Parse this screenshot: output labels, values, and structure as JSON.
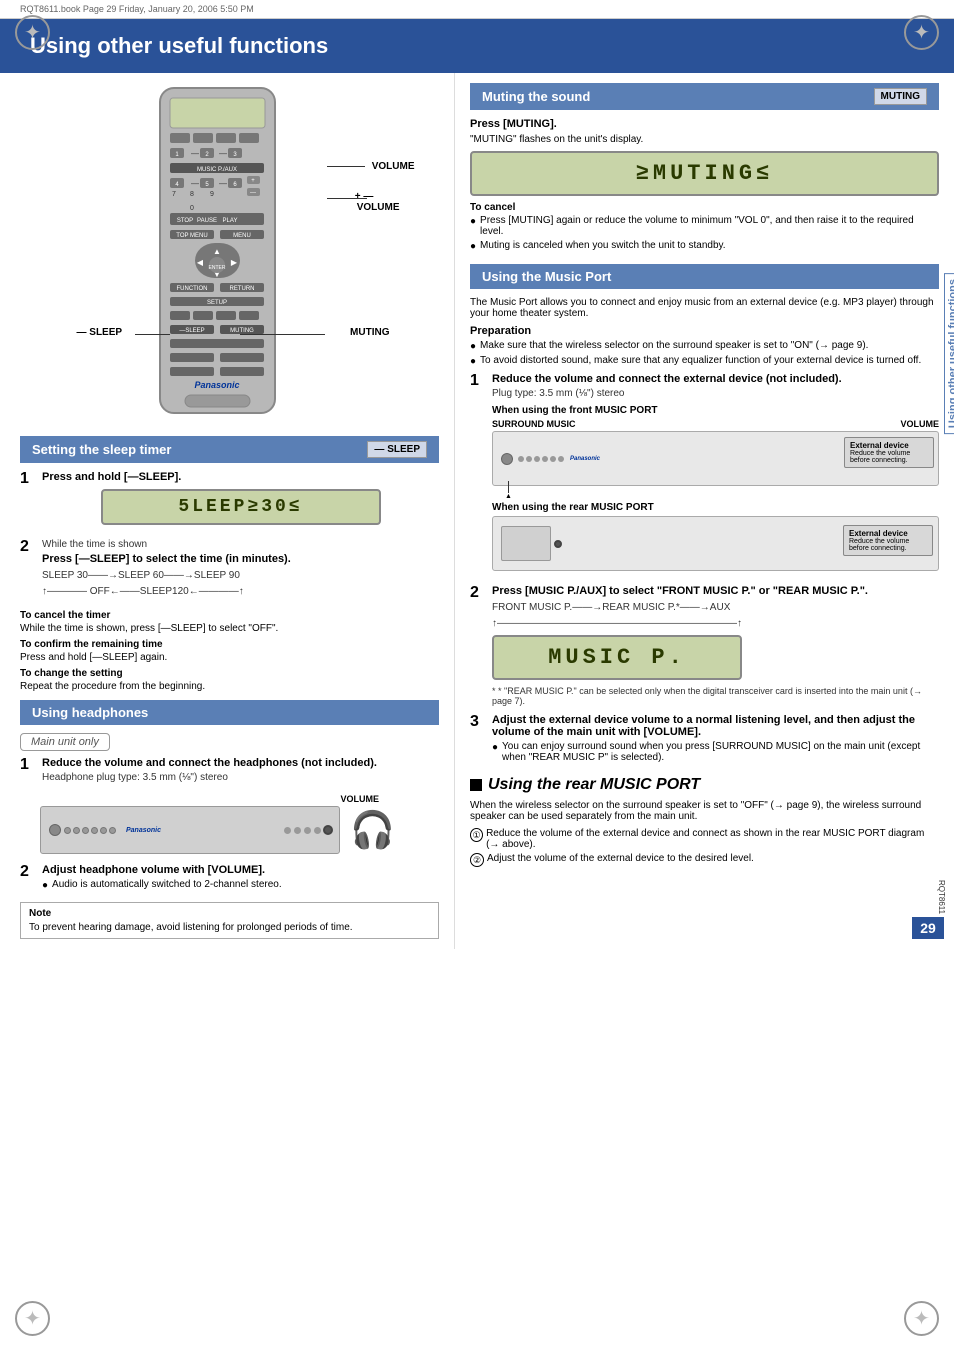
{
  "page": {
    "title": "Using other useful functions",
    "file_info": "RQT8611.book  Page 29  Friday, January 20, 2006  5:50 PM",
    "page_number": "29",
    "rqt_code": "RQT8611",
    "side_label": "Using other useful functions"
  },
  "left_col": {
    "sleep_section": {
      "header": "Setting the sleep timer",
      "badge": "— SLEEP",
      "step1_title": "Press and hold [—SLEEP].",
      "sleep_display": "5LEEP≥30≤",
      "step2_title": "While the time is shown",
      "step2_sub": "Press [—SLEEP] to select the time (in minutes).",
      "sleep_chain": "SLEEP 30——→SLEEP 60——→SLEEP 90",
      "sleep_chain2": "↑———— OFF←——SLEEP120←————↑",
      "cancel_title": "To cancel the timer",
      "cancel_text": "While the time is shown, press [—SLEEP] to select \"OFF\".",
      "confirm_title": "To confirm the remaining time",
      "confirm_text": "Press and hold [—SLEEP] again.",
      "change_title": "To change the setting",
      "change_text": "Repeat the procedure from the beginning."
    },
    "headphones_section": {
      "header": "Using headphones",
      "badge_text": "Main unit only",
      "step1_title": "Reduce the volume and connect the headphones (not included).",
      "step1_sub": "Headphone plug type:  3.5 mm (⅛\") stereo",
      "volume_label": "VOLUME",
      "step2_title": "Adjust headphone volume with [VOLUME].",
      "step2_bullet": "Audio is automatically switched to 2-channel stereo.",
      "note_title": "Note",
      "note_text": "To prevent hearing damage, avoid listening for prolonged periods of time."
    }
  },
  "right_col": {
    "muting_section": {
      "header": "Muting the sound",
      "badge": "MUTING",
      "step_title": "Press [MUTING].",
      "step_sub": "\"MUTING\" flashes on the unit's display.",
      "muting_display": "≥MUTING≤",
      "cancel_title": "To cancel",
      "cancel_bullet1": "Press [MUTING] again or reduce the volume to minimum \"VOL 0\", and then raise it to the required level.",
      "cancel_bullet2": "Muting is canceled when you switch the unit to standby."
    },
    "music_port_section": {
      "header": "Using the Music Port",
      "intro": "The Music Port allows you to connect and enjoy music from an external device (e.g. MP3 player) through your home theater system.",
      "prep_title": "Preparation",
      "prep_bullet1": "Make sure that the wireless selector on the surround speaker is set to \"ON\" (→ page 9).",
      "prep_bullet2": "To avoid distorted sound, make sure that any equalizer function of your external device is turned off.",
      "step1_title": "Reduce the volume and connect the external device (not included).",
      "step1_sub": "Plug type:  3.5 mm (⅛\") stereo",
      "front_port_title": "When using the front MUSIC PORT",
      "surround_music_label": "SURROUND MUSIC",
      "volume_label": "VOLUME",
      "external_device_label": "External device",
      "external_device_sub": "Reduce the volume before connecting.",
      "rear_port_title": "When using the rear MUSIC PORT",
      "external_device_label2": "External device",
      "external_device_sub2": "Reduce the volume before connecting.",
      "step2_title": "Press [MUSIC P./AUX] to select \"FRONT MUSIC P.\" or \"REAR MUSIC P.\".",
      "step2_chain": "FRONT MUSIC P.——→REAR MUSIC P.*——→AUX",
      "step2_chain2": "↑————————————————————————↑",
      "music_display": "MUSIC P.",
      "footnote": "* \"REAR MUSIC P.\" can be selected only when the digital transceiver card is inserted into the main unit (→ page 7).",
      "step3_title": "Adjust the external device volume to a normal listening level, and then adjust the volume of the main unit with [VOLUME].",
      "step3_bullet": "You can enjoy surround sound when you press [SURROUND MUSIC] on the main unit (except when \"REAR MUSIC P\" is selected)."
    },
    "rear_music_port_section": {
      "header": "Using the rear MUSIC PORT",
      "intro": "When the wireless selector on the surround speaker is set to \"OFF\" (→ page 9), the wireless surround speaker can be used separately from the main unit.",
      "circle1_title": "Reduce the volume of the external device and connect as shown in the rear MUSIC PORT diagram (→ above).",
      "circle2_title": "Adjust the volume of the external device to the desired level."
    }
  }
}
